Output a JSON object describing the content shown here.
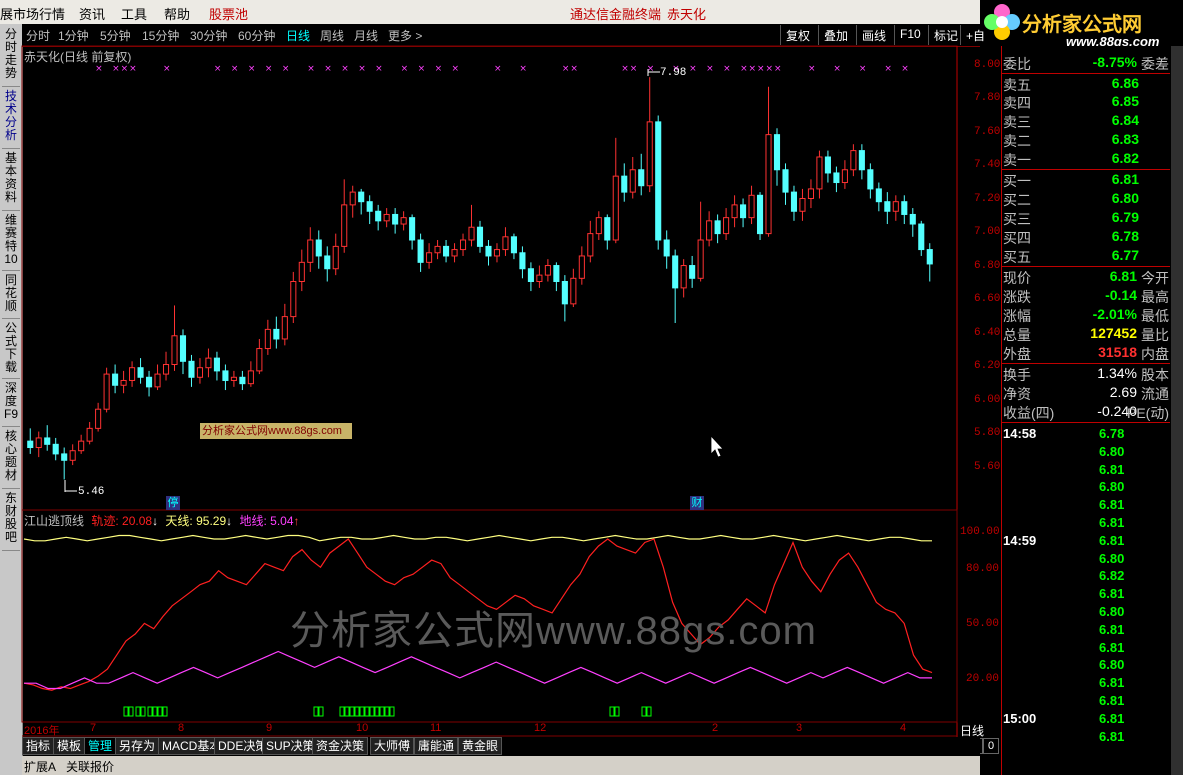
{
  "menubar": {
    "items": [
      "展市场行情",
      "资讯",
      "工具",
      "帮助",
      "股票池"
    ],
    "center_title": "通达信金融终端",
    "center_stock": "赤天化"
  },
  "logo": {
    "title": "分析家公式网",
    "url": "www.88gs.com"
  },
  "left_tabs": [
    "分时走势",
    "技术分析",
    "基本资料",
    "维赛特10",
    "同花顺",
    "公式下载",
    "深度F9",
    "核心题材",
    "东财股吧"
  ],
  "period_bar": {
    "periods": [
      "分时",
      "1分钟",
      "5分钟",
      "15分钟",
      "30分钟",
      "60分钟",
      "日线",
      "周线",
      "月线",
      "更多 >"
    ],
    "selected_index": 6,
    "buttons": [
      "复权",
      "叠加",
      "画线",
      "F10",
      "标记",
      "+自"
    ]
  },
  "chart_title": "赤天化(日线 前复权)",
  "price_axis": [
    "8.00",
    "7.80",
    "7.60",
    "7.40",
    "7.20",
    "7.00",
    "6.80",
    "6.60",
    "6.40",
    "6.20",
    "6.00",
    "5.80",
    "5.60"
  ],
  "price_high_label": "7.98",
  "price_low_label": "5.46",
  "markers": {
    "stop": "停",
    "fin": "财"
  },
  "ad_tag": "分析家公式网www.88gs.com",
  "indicator": {
    "name": "江山逃顶线",
    "guiji_label": "轨迹:",
    "guiji_value": "20.08",
    "tianxian_label": "天线:",
    "tianxian_value": "95.29",
    "dixian_label": "地线:",
    "dixian_value": "5.04",
    "axis": [
      "100.00",
      "80.00",
      "50.00",
      "20.00"
    ],
    "colors": {
      "guiji": "#ff2020",
      "tianxian": "#ffff80",
      "dixian": "#ff40ff"
    }
  },
  "watermark": "分析家公式网www.88gs.com",
  "time_axis": [
    "2016年",
    "7",
    "8",
    "9",
    "10",
    "11",
    "12",
    "2",
    "3",
    "4"
  ],
  "period_label": "日线",
  "zoom_buttons": [
    "+",
    "-",
    "0"
  ],
  "bottom_tabs": [
    "指标",
    "模板",
    "管理",
    "另存为",
    "MACD基本",
    "DDE决策",
    "SUP决策",
    "资金决策",
    "大师傅",
    "庸能通",
    "黄金眼"
  ],
  "bottom_selected": 2,
  "bottom_row2": [
    "扩展A",
    "关联报价"
  ],
  "quote": {
    "weibi_label": "委比",
    "weibi_value": "-8.75%",
    "weicha_label": "委差",
    "asks": [
      {
        "label": "卖五",
        "price": "6.86"
      },
      {
        "label": "卖四",
        "price": "6.85"
      },
      {
        "label": "卖三",
        "price": "6.84"
      },
      {
        "label": "卖二",
        "price": "6.83"
      },
      {
        "label": "卖一",
        "price": "6.82"
      }
    ],
    "bids": [
      {
        "label": "买一",
        "price": "6.81"
      },
      {
        "label": "买二",
        "price": "6.80"
      },
      {
        "label": "买三",
        "price": "6.79"
      },
      {
        "label": "买四",
        "price": "6.78"
      },
      {
        "label": "买五",
        "price": "6.77"
      }
    ],
    "stats": [
      {
        "label": "现价",
        "value": "6.81",
        "label2": "今开",
        "color": "#00ff00"
      },
      {
        "label": "涨跌",
        "value": "-0.14",
        "label2": "最高",
        "color": "#00ff00"
      },
      {
        "label": "涨幅",
        "value": "-2.01%",
        "label2": "最低",
        "color": "#00ff00"
      },
      {
        "label": "总量",
        "value": "127452",
        "label2": "量比",
        "color": "#ffff00"
      },
      {
        "label": "外盘",
        "value": "31518",
        "label2": "内盘",
        "color": "#ff3030"
      }
    ],
    "stats2": [
      {
        "label": "换手",
        "value": "1.34%",
        "label2": "股本",
        "color": "#ffffff"
      },
      {
        "label": "净资",
        "value": "2.69",
        "label2": "流通",
        "color": "#ffffff"
      },
      {
        "label": "收益(四)",
        "value": "-0.240",
        "label2": "PE(动)",
        "color": "#ffffff"
      }
    ],
    "ticks": [
      {
        "time": "14:58",
        "price": "6.78"
      },
      {
        "time": "",
        "price": "6.80"
      },
      {
        "time": "",
        "price": "6.81"
      },
      {
        "time": "",
        "price": "6.80"
      },
      {
        "time": "",
        "price": "6.81"
      },
      {
        "time": "",
        "price": "6.81"
      },
      {
        "time": "14:59",
        "price": "6.81"
      },
      {
        "time": "",
        "price": "6.80"
      },
      {
        "time": "",
        "price": "6.82"
      },
      {
        "time": "",
        "price": "6.81"
      },
      {
        "time": "",
        "price": "6.80"
      },
      {
        "time": "",
        "price": "6.81"
      },
      {
        "time": "",
        "price": "6.81"
      },
      {
        "time": "",
        "price": "6.80"
      },
      {
        "time": "",
        "price": "6.81"
      },
      {
        "time": "",
        "price": "6.81"
      },
      {
        "time": "15:00",
        "price": "6.81"
      },
      {
        "time": "",
        "price": "6.81"
      }
    ]
  },
  "chart_data": {
    "type": "candlestick",
    "ylim": [
      5.35,
      8.05
    ],
    "candles": [
      [
        5.7,
        5.66,
        5.78,
        5.62
      ],
      [
        5.66,
        5.72,
        5.76,
        5.6
      ],
      [
        5.72,
        5.68,
        5.8,
        5.64
      ],
      [
        5.68,
        5.62,
        5.72,
        5.58
      ],
      [
        5.62,
        5.58,
        5.66,
        5.46
      ],
      [
        5.58,
        5.64,
        5.68,
        5.55
      ],
      [
        5.64,
        5.7,
        5.74,
        5.62
      ],
      [
        5.7,
        5.78,
        5.82,
        5.68
      ],
      [
        5.78,
        5.9,
        5.94,
        5.76
      ],
      [
        5.9,
        6.12,
        6.16,
        5.88
      ],
      [
        6.12,
        6.05,
        6.18,
        6.0
      ],
      [
        6.05,
        6.08,
        6.14,
        6.0
      ],
      [
        6.08,
        6.16,
        6.2,
        6.04
      ],
      [
        6.16,
        6.1,
        6.22,
        6.06
      ],
      [
        6.1,
        6.04,
        6.14,
        5.98
      ],
      [
        6.04,
        6.12,
        6.18,
        6.02
      ],
      [
        6.12,
        6.18,
        6.26,
        6.08
      ],
      [
        6.18,
        6.36,
        6.55,
        6.14
      ],
      [
        6.36,
        6.2,
        6.4,
        6.12
      ],
      [
        6.2,
        6.1,
        6.24,
        6.04
      ],
      [
        6.1,
        6.16,
        6.22,
        6.06
      ],
      [
        6.16,
        6.22,
        6.28,
        6.1
      ],
      [
        6.22,
        6.14,
        6.26,
        6.08
      ],
      [
        6.14,
        6.08,
        6.18,
        6.02
      ],
      [
        6.08,
        6.1,
        6.14,
        6.04
      ],
      [
        6.1,
        6.06,
        6.14,
        6.02
      ],
      [
        6.06,
        6.14,
        6.2,
        6.04
      ],
      [
        6.14,
        6.28,
        6.34,
        6.12
      ],
      [
        6.28,
        6.4,
        6.46,
        6.24
      ],
      [
        6.4,
        6.34,
        6.48,
        6.28
      ],
      [
        6.34,
        6.48,
        6.56,
        6.3
      ],
      [
        6.48,
        6.7,
        6.76,
        6.44
      ],
      [
        6.7,
        6.82,
        6.9,
        6.64
      ],
      [
        6.82,
        6.96,
        7.04,
        6.76
      ],
      [
        6.96,
        6.86,
        7.02,
        6.78
      ],
      [
        6.86,
        6.78,
        6.92,
        6.7
      ],
      [
        6.78,
        6.92,
        7.0,
        6.74
      ],
      [
        6.92,
        7.18,
        7.34,
        6.88
      ],
      [
        7.18,
        7.26,
        7.3,
        7.1
      ],
      [
        7.26,
        7.2,
        7.28,
        7.12
      ],
      [
        7.2,
        7.14,
        7.24,
        7.06
      ],
      [
        7.14,
        7.08,
        7.18,
        7.02
      ],
      [
        7.08,
        7.12,
        7.16,
        7.04
      ],
      [
        7.12,
        7.06,
        7.16,
        7.0
      ],
      [
        7.06,
        7.1,
        7.14,
        7.02
      ],
      [
        7.1,
        6.96,
        7.12,
        6.9
      ],
      [
        6.96,
        6.82,
        7.0,
        6.76
      ],
      [
        6.82,
        6.88,
        6.94,
        6.78
      ],
      [
        6.88,
        6.92,
        6.96,
        6.84
      ],
      [
        6.92,
        6.86,
        6.96,
        6.82
      ],
      [
        6.86,
        6.9,
        6.94,
        6.82
      ],
      [
        6.9,
        6.96,
        7.0,
        6.86
      ],
      [
        6.96,
        7.04,
        7.18,
        6.92
      ],
      [
        7.04,
        6.92,
        7.08,
        6.88
      ],
      [
        6.92,
        6.86,
        6.96,
        6.8
      ],
      [
        6.86,
        6.9,
        6.94,
        6.82
      ],
      [
        6.9,
        6.98,
        7.04,
        6.86
      ],
      [
        6.98,
        6.88,
        7.0,
        6.84
      ],
      [
        6.88,
        6.78,
        6.92,
        6.72
      ],
      [
        6.78,
        6.7,
        6.82,
        6.64
      ],
      [
        6.7,
        6.74,
        6.8,
        6.66
      ],
      [
        6.74,
        6.8,
        6.84,
        6.7
      ],
      [
        6.8,
        6.7,
        6.82,
        6.64
      ],
      [
        6.7,
        6.56,
        6.74,
        6.45
      ],
      [
        6.56,
        6.72,
        6.78,
        6.54
      ],
      [
        6.72,
        6.86,
        6.92,
        6.68
      ],
      [
        6.86,
        7.0,
        7.08,
        6.82
      ],
      [
        7.0,
        7.1,
        7.14,
        6.96
      ],
      [
        7.1,
        6.96,
        7.12,
        6.9
      ],
      [
        6.96,
        7.36,
        7.6,
        6.94
      ],
      [
        7.36,
        7.26,
        7.44,
        7.2
      ],
      [
        7.26,
        7.4,
        7.48,
        7.22
      ],
      [
        7.4,
        7.3,
        7.5,
        7.24
      ],
      [
        7.3,
        7.7,
        7.98,
        7.26
      ],
      [
        7.7,
        6.96,
        7.74,
        6.9
      ],
      [
        6.96,
        6.86,
        7.02,
        6.78
      ],
      [
        6.86,
        6.66,
        6.9,
        6.44
      ],
      [
        6.66,
        6.8,
        6.84,
        6.6
      ],
      [
        6.8,
        6.72,
        6.86,
        6.66
      ],
      [
        6.72,
        6.96,
        7.2,
        6.7
      ],
      [
        6.96,
        7.08,
        7.14,
        6.92
      ],
      [
        7.08,
        7.0,
        7.12,
        6.94
      ],
      [
        7.0,
        7.1,
        7.16,
        6.96
      ],
      [
        7.1,
        7.18,
        7.24,
        7.04
      ],
      [
        7.18,
        7.1,
        7.22,
        7.04
      ],
      [
        7.1,
        7.24,
        7.3,
        7.06
      ],
      [
        7.24,
        7.0,
        7.26,
        6.96
      ],
      [
        7.0,
        7.62,
        7.92,
        6.98
      ],
      [
        7.62,
        7.4,
        7.66,
        7.3
      ],
      [
        7.4,
        7.26,
        7.44,
        7.18
      ],
      [
        7.26,
        7.14,
        7.3,
        7.08
      ],
      [
        7.14,
        7.22,
        7.28,
        7.08
      ],
      [
        7.22,
        7.28,
        7.34,
        7.16
      ],
      [
        7.28,
        7.48,
        7.52,
        7.22
      ],
      [
        7.48,
        7.38,
        7.52,
        7.32
      ],
      [
        7.38,
        7.32,
        7.42,
        7.26
      ],
      [
        7.32,
        7.4,
        7.46,
        7.28
      ],
      [
        7.4,
        7.52,
        7.56,
        7.36
      ],
      [
        7.52,
        7.4,
        7.56,
        7.34
      ],
      [
        7.4,
        7.28,
        7.44,
        7.22
      ],
      [
        7.28,
        7.2,
        7.32,
        7.14
      ],
      [
        7.2,
        7.14,
        7.26,
        7.06
      ],
      [
        7.14,
        7.2,
        7.24,
        7.08
      ],
      [
        7.2,
        7.12,
        7.24,
        7.06
      ],
      [
        7.12,
        7.06,
        7.16,
        6.98
      ],
      [
        7.06,
        6.9,
        7.08,
        6.86
      ],
      [
        6.9,
        6.81,
        6.94,
        6.7
      ]
    ],
    "indicator_series": {
      "guiji": [
        14,
        13,
        11,
        10,
        12,
        11,
        13,
        15,
        18,
        22,
        30,
        38,
        42,
        48,
        45,
        52,
        58,
        62,
        66,
        70,
        72,
        78,
        74,
        72,
        70,
        76,
        82,
        80,
        78,
        86,
        90,
        84,
        80,
        88,
        92,
        96,
        88,
        80,
        76,
        72,
        70,
        74,
        76,
        80,
        84,
        82,
        74,
        70,
        66,
        62,
        58,
        56,
        60,
        64,
        62,
        58,
        56,
        54,
        62,
        70,
        76,
        86,
        92,
        96,
        92,
        90,
        88,
        94,
        96,
        80,
        60,
        48,
        42,
        36,
        40,
        46,
        50,
        56,
        62,
        58,
        54,
        70,
        82,
        94,
        80,
        72,
        66,
        76,
        84,
        88,
        80,
        70,
        60,
        56,
        54,
        48,
        30,
        22,
        20
      ],
      "tianxian": [
        96,
        95,
        95,
        96,
        97,
        96,
        95,
        96,
        97,
        98,
        98,
        97,
        96,
        95,
        96,
        97,
        98,
        97,
        96,
        96,
        97,
        98,
        97,
        96,
        97,
        98,
        98,
        97,
        95,
        96,
        97,
        97,
        96,
        96,
        97,
        98,
        97,
        96,
        96,
        97,
        97,
        96,
        95,
        96,
        97,
        98,
        97,
        96,
        95,
        96,
        97,
        97,
        96,
        95,
        96,
        97,
        98,
        97,
        96,
        96,
        97,
        98,
        97,
        96,
        96,
        97,
        98,
        97,
        96,
        96,
        97,
        98,
        97,
        96,
        95,
        96,
        97,
        98,
        97,
        96,
        95,
        96,
        97,
        97,
        96,
        95,
        95
      ],
      "dixian": [
        4,
        4,
        3,
        3,
        4,
        5,
        4,
        4,
        5,
        6,
        5,
        4,
        5,
        6,
        7,
        6,
        5,
        6,
        7,
        8,
        9,
        10,
        9,
        8,
        7,
        8,
        9,
        8,
        7,
        6,
        7,
        8,
        9,
        8,
        7,
        6,
        5,
        6,
        7,
        8,
        7,
        6,
        5,
        4,
        5,
        6,
        7,
        6,
        5,
        4,
        5,
        6,
        5,
        4,
        5,
        6,
        5,
        4,
        5,
        6,
        7,
        6,
        5,
        4,
        5,
        6,
        5,
        6,
        7,
        6,
        5,
        4,
        5,
        6,
        5,
        5
      ]
    }
  }
}
